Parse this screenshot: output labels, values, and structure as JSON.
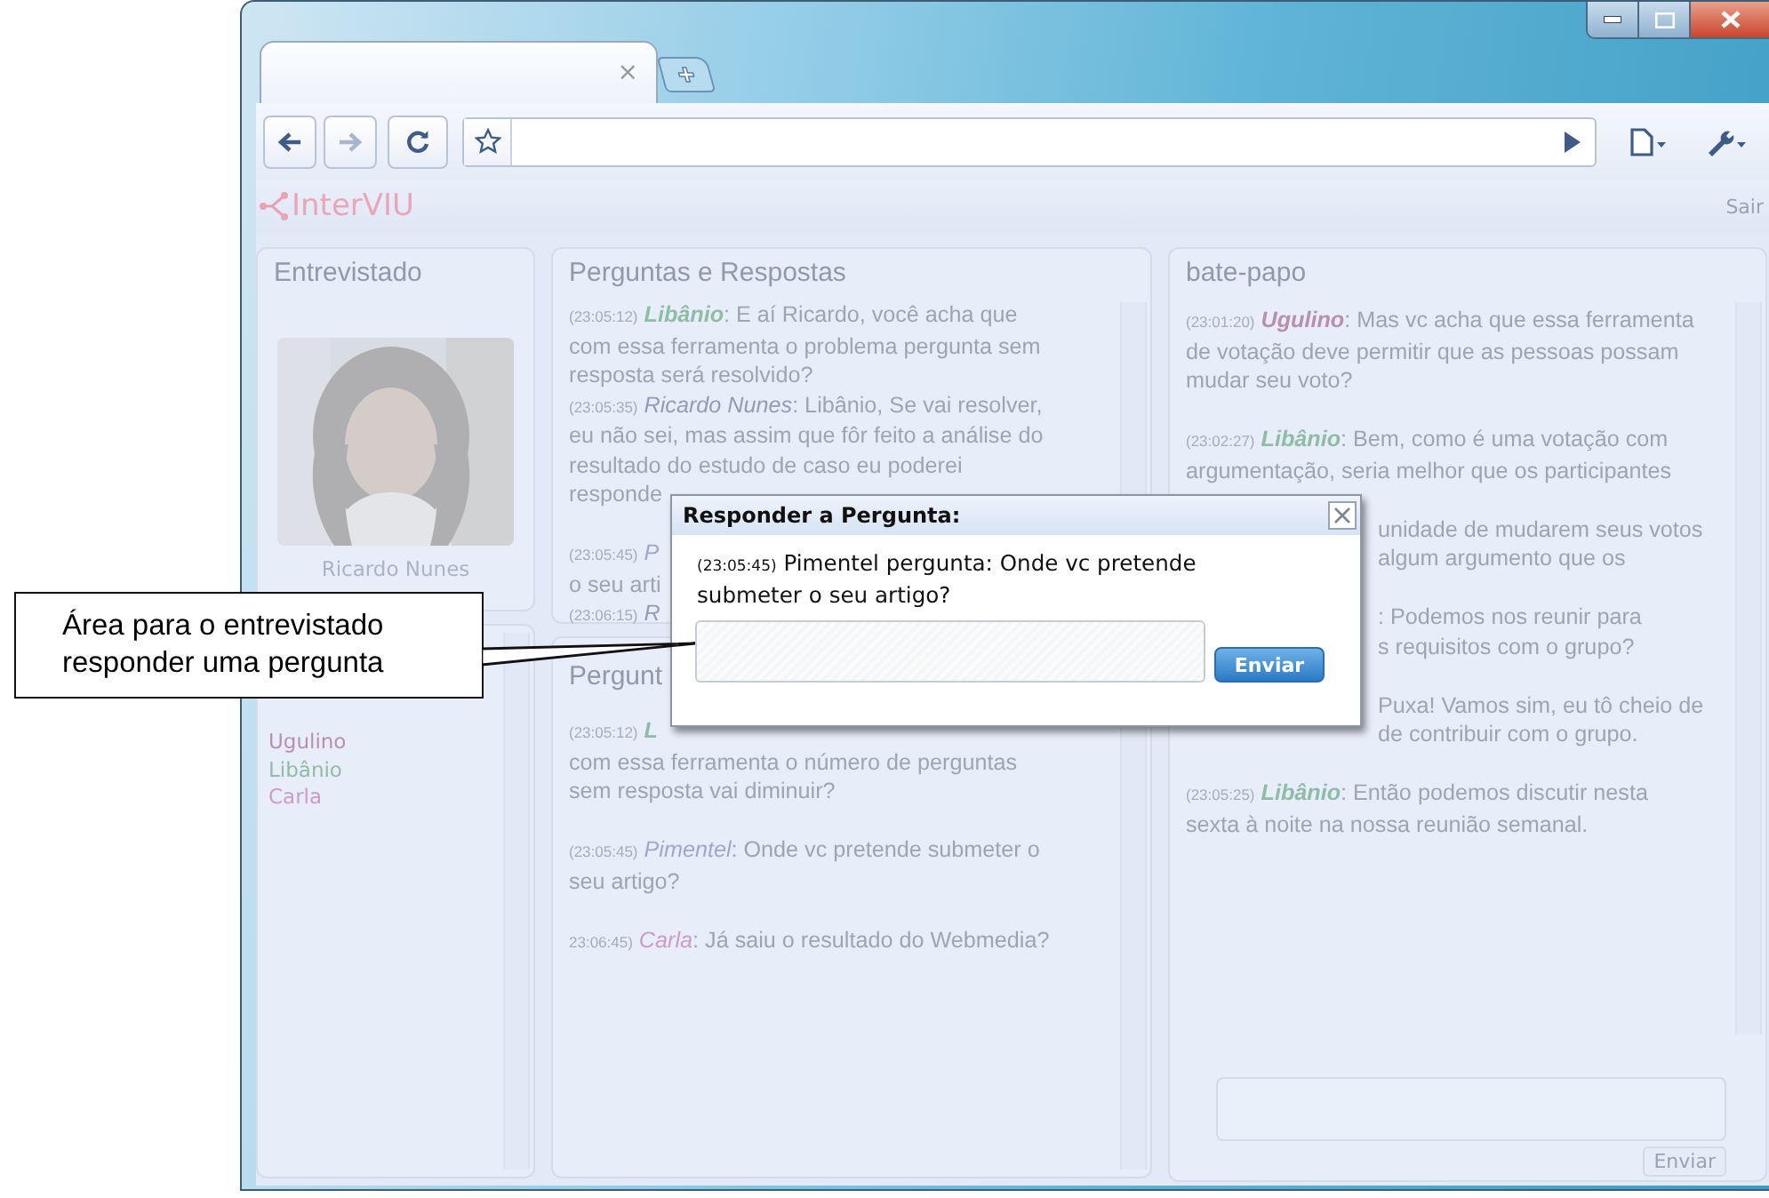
{
  "browser": {
    "tab_close": "×"
  },
  "app": {
    "logo": "InterVIU",
    "logout": "Sair"
  },
  "interviewee": {
    "title": "Entrevistado",
    "name": "Ricardo Nunes"
  },
  "participants": [
    {
      "name": "Ugulino",
      "color": "#b88fae"
    },
    {
      "name": "Libânio",
      "color": "#8fbca4"
    },
    {
      "name": "Carla",
      "color": "#c99dc6"
    }
  ],
  "qa": {
    "title": "Perguntas e Respostas",
    "groups": [
      [
        {
          "kind": "message",
          "time": "(23:05:12)",
          "author": "Libânio",
          "color": "#8fbca4",
          "bold": true,
          "lines": [
            ": E aí Ricardo, você acha que",
            "com essa ferramenta o problema pergunta sem",
            "resposta será resolvido?"
          ]
        },
        {
          "kind": "message",
          "time": "(23:05:35)",
          "author": "Ricardo Nunes",
          "color": "#939cb3",
          "bold": false,
          "lines": [
            ": Libânio, Se vai resolver,",
            "eu não sei, mas assim que fôr feito a análise do",
            "resultado do estudo de caso eu poderei",
            "responde"
          ]
        }
      ],
      [
        {
          "kind": "cut",
          "time": "(23:05:45)",
          "author": "P",
          "color": "#a3a6c9",
          "bold": false,
          "lines": [
            "o seu arti"
          ]
        },
        {
          "kind": "cut",
          "time": "(23:06:15)",
          "author": "R",
          "color": "#939cb3",
          "bold": false
        }
      ]
    ]
  },
  "questions": {
    "title": "Pergunt",
    "groups": [
      [
        {
          "kind": "cut",
          "time": "(23:05:12)",
          "author": "L",
          "color": "#8fbca4",
          "bold": true,
          "lines": [
            "com essa ferramenta o número de perguntas",
            "sem resposta vai diminuir?"
          ]
        }
      ],
      [
        {
          "kind": "message",
          "time": "(23:05:45)",
          "author": "Pimentel",
          "color": "#a3a6c9",
          "bold": false,
          "lines": [
            ": Onde vc pretende submeter o",
            "seu artigo?"
          ]
        }
      ],
      [
        {
          "kind": "message",
          "time": "23:06:45)",
          "author": "Carla",
          "color": "#c99dc6",
          "bold": false,
          "lines": [
            ": Já saiu o resultado do Webmedia?"
          ]
        }
      ]
    ]
  },
  "chat": {
    "title": "bate-papo",
    "groups": [
      [
        {
          "kind": "message",
          "time": "(23:01:20)",
          "author": "Ugulino",
          "color": "#b88fae",
          "bold": true,
          "lines": [
            ": Mas vc acha que essa ferramenta",
            "de votação deve permitir que as pessoas possam",
            "mudar seu voto?"
          ]
        }
      ],
      [
        {
          "kind": "message",
          "time": "(23:02:27)",
          "author": "Libânio",
          "color": "#8fbca4",
          "bold": true,
          "lines": [
            ": Bem, como é uma votação com",
            "argumentação, seria melhor que os participantes"
          ],
          "tail": [
            "unidade de mudarem seus votos",
            "algum argumento que os"
          ]
        }
      ],
      [
        {
          "kind": "tail",
          "lines": [
            ": Podemos nos reunir para",
            "s requisitos com o grupo?"
          ]
        }
      ],
      [
        {
          "kind": "tail",
          "lines": [
            "Puxa! Vamos sim, eu tô cheio de",
            "de contribuir com o grupo."
          ]
        }
      ],
      [
        {
          "kind": "message",
          "time": "(23:05:25)",
          "author": "Libânio",
          "color": "#8fbca4",
          "bold": true,
          "lines": [
            ": Então podemos discutir nesta",
            "sexta à noite na nossa reunião semanal."
          ]
        }
      ]
    ],
    "send_button": "Enviar"
  },
  "dialog": {
    "title": "Responder a Pergunta:",
    "time": "(23:05:45)",
    "question": "Pimentel pergunta: Onde vc pretende submeter o seu artigo?",
    "send_button": "Enviar"
  },
  "callout": {
    "text": "Área para o entrevistado responder uma pergunta"
  }
}
